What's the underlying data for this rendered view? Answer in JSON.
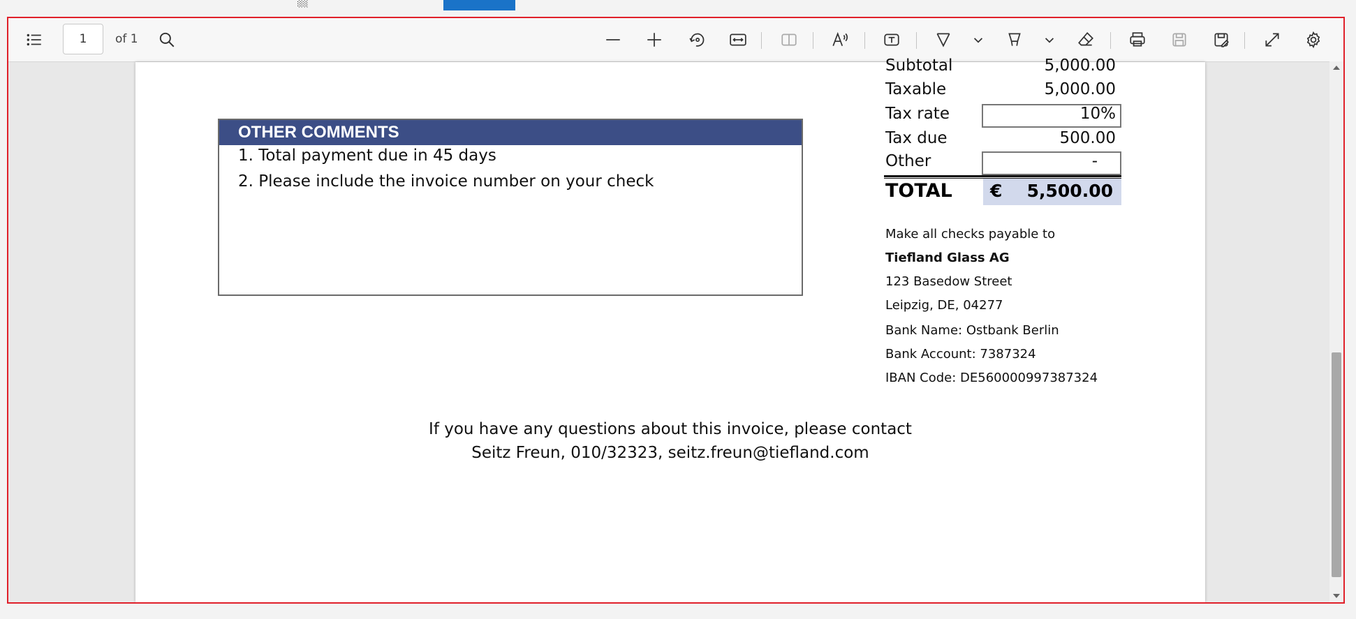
{
  "toolbar": {
    "page_number": "1",
    "page_of": "of 1"
  },
  "comments": {
    "header": "OTHER COMMENTS",
    "lines": [
      "1. Total payment due in 45 days",
      "2. Please include the invoice number on your check"
    ]
  },
  "summary": {
    "subtotal_label": "Subtotal",
    "subtotal_value": "5,000.00",
    "taxable_label": "Taxable",
    "taxable_value": "5,000.00",
    "tax_rate_label": "Tax rate",
    "tax_rate_value": "10%",
    "tax_due_label": "Tax due",
    "tax_due_value": "500.00",
    "other_label": "Other",
    "other_value": "-",
    "total_label": "TOTAL",
    "total_currency": "€",
    "total_value": "5,500.00",
    "total_bg_color": "#d2d9ec"
  },
  "payment": {
    "lines": [
      "Make all checks payable to",
      "Tiefland Glass AG",
      "123 Basedow Street",
      "Leipzig, DE, 04277",
      "Bank Name: Ostbank Berlin",
      "Bank Account: 7387324",
      "IBAN Code: DE560000997387324"
    ]
  },
  "contact": {
    "line1": "If you have any questions about this invoice, please contact",
    "line2": "Seitz Freun, 010/32323, seitz.freun@tiefland.com"
  },
  "colors": {
    "accent_header": "#3c4e86",
    "frame_border": "#e0202a"
  }
}
